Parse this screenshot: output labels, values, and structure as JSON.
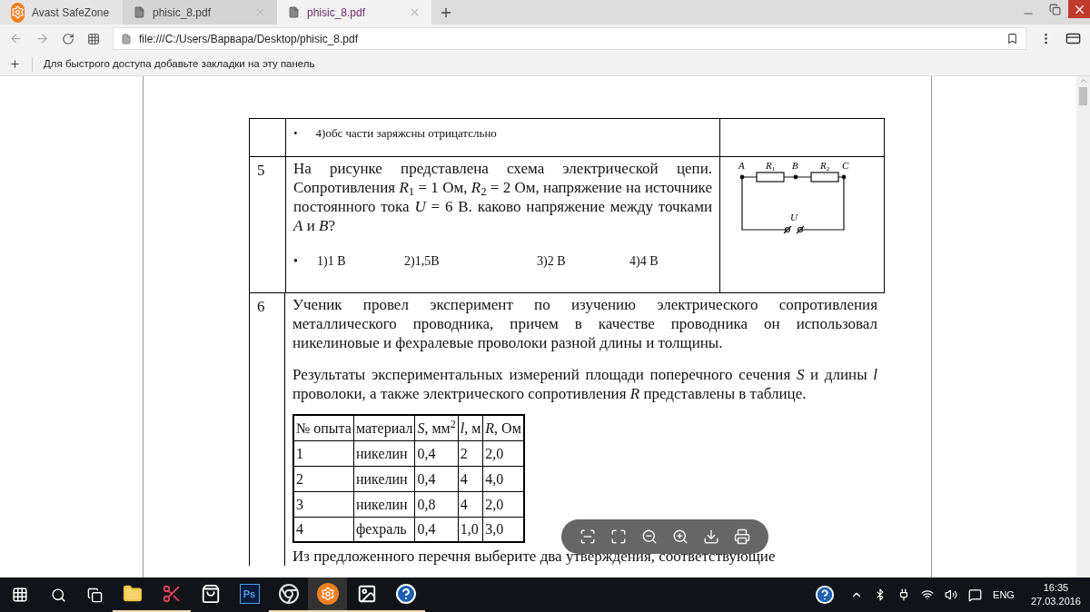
{
  "tabs": [
    {
      "kind": "app",
      "label": "Avast SafeZone",
      "selected": false
    },
    {
      "kind": "page",
      "label": "phisic_8.pdf",
      "selected": false
    },
    {
      "kind": "page",
      "label": "phisic_8.pdf",
      "selected": true
    }
  ],
  "address": "file:///C:/Users/Варвара/Desktop/phisic_8.pdf",
  "bookmarks_hint": "Для быстрого доступа добавьте закладки на эту панель",
  "document": {
    "top_row": {
      "bullet": "•",
      "text": "4)обс части заряжсны отрицатсльно"
    },
    "q5": {
      "number": "5",
      "text": "На рисунке представлена схема электрической цепи. Сопротивления *R*$_{1}$ = 1 Ом, *R*$_{2}$ = 2 Ом, напряжение на источнике постоянного тока *U* = 6 В. каково напряжение между точками *A* и *B*?",
      "bullet": "•",
      "answers": [
        "1)1 В",
        "2)1,5В",
        "3)2 В",
        "4)4 В"
      ],
      "circuit": {
        "points": [
          "A",
          "B",
          "C"
        ],
        "resistors": [
          "R",
          "R"
        ],
        "resistor_indexes": [
          "1",
          "2"
        ],
        "source": "U"
      }
    },
    "q6": {
      "number": "6",
      "paragraphs": [
        "Ученик провел эксперимент по изучению электрического сопротивления металлического проводника, причем в качестве проводника он использовал никелиновые и фехралевые проволоки разной длины и толщины.",
        "Результаты экспериментальных измерений площади поперечного сечения *S* и длины *l* проволоки, а также электрического сопротивления *R* представлены в таблице."
      ],
      "table": {
        "columns": [
          "№ опыта",
          "материал",
          "*S*, мм$^{2}$",
          "*l*, м",
          "*R*, Ом"
        ],
        "rows": [
          [
            "1",
            "никелин",
            "0,4",
            "2",
            "2,0"
          ],
          [
            "2",
            "никелин",
            "0,4",
            "4",
            "4,0"
          ],
          [
            "3",
            "никелин",
            "0,8",
            "4",
            "2,0"
          ],
          [
            "4",
            "фехраль",
            "0,4",
            "1,0",
            "3,0"
          ]
        ]
      },
      "next_text": "Из предложенного перечня выберите два утверждения, соответствующие"
    }
  },
  "taskbar": {
    "apps": [
      {
        "kind": "explorer",
        "running": true
      },
      {
        "kind": "snipping",
        "running": true
      },
      {
        "kind": "store",
        "running": false
      },
      {
        "kind": "photoshop",
        "label": "Ps",
        "running": false
      },
      {
        "kind": "chrome",
        "running": true
      },
      {
        "kind": "avast",
        "running": true
      },
      {
        "kind": "photos",
        "running": true
      },
      {
        "kind": "help",
        "running": true
      }
    ],
    "language": "ENG",
    "time": "16:35",
    "date": "27.03.2016"
  }
}
